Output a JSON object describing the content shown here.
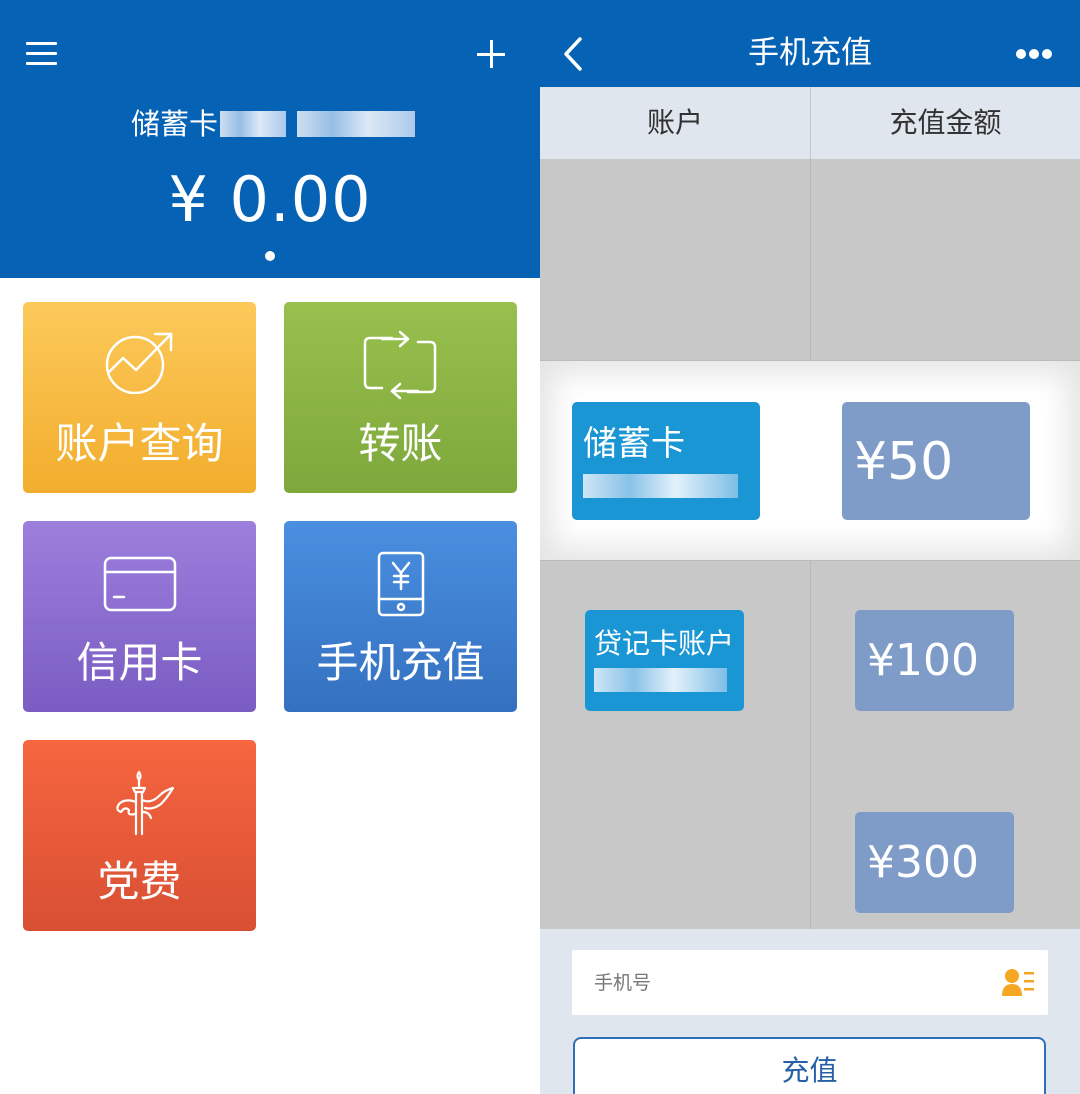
{
  "home": {
    "header": {
      "card_label": "储蓄卡",
      "balance": "¥ 0.00"
    },
    "tiles": [
      {
        "label": "账户查询",
        "icon": "trend-up-icon",
        "color": "#f2ad2d"
      },
      {
        "label": "转账",
        "icon": "transfer-icon",
        "color": "#7ea83c"
      },
      {
        "label": "信用卡",
        "icon": "credit-card-icon",
        "color": "#7a5cc3"
      },
      {
        "label": "手机充值",
        "icon": "phone-yuan-icon",
        "color": "#3470c0"
      },
      {
        "label": "党费",
        "icon": "huabiao-icon",
        "color": "#d84f33"
      }
    ]
  },
  "recharge": {
    "title": "手机充值",
    "columns": {
      "account": "账户",
      "amount": "充值金额"
    },
    "accounts": [
      {
        "name": "储蓄卡",
        "selected": true
      },
      {
        "name": "贷记卡账户",
        "selected": false
      }
    ],
    "amounts": [
      {
        "value": "¥50",
        "selected": true
      },
      {
        "value": "¥100",
        "selected": false
      },
      {
        "value": "¥300",
        "selected": false
      }
    ],
    "phone_placeholder": "手机号",
    "submit_label": "充值"
  },
  "colors": {
    "brand_blue": "#0562b5",
    "account_card": "#1a96d4",
    "amount_card": "#7f9cc9",
    "picker_bg": "#c8c8c8",
    "contact_icon": "#f5a623"
  }
}
